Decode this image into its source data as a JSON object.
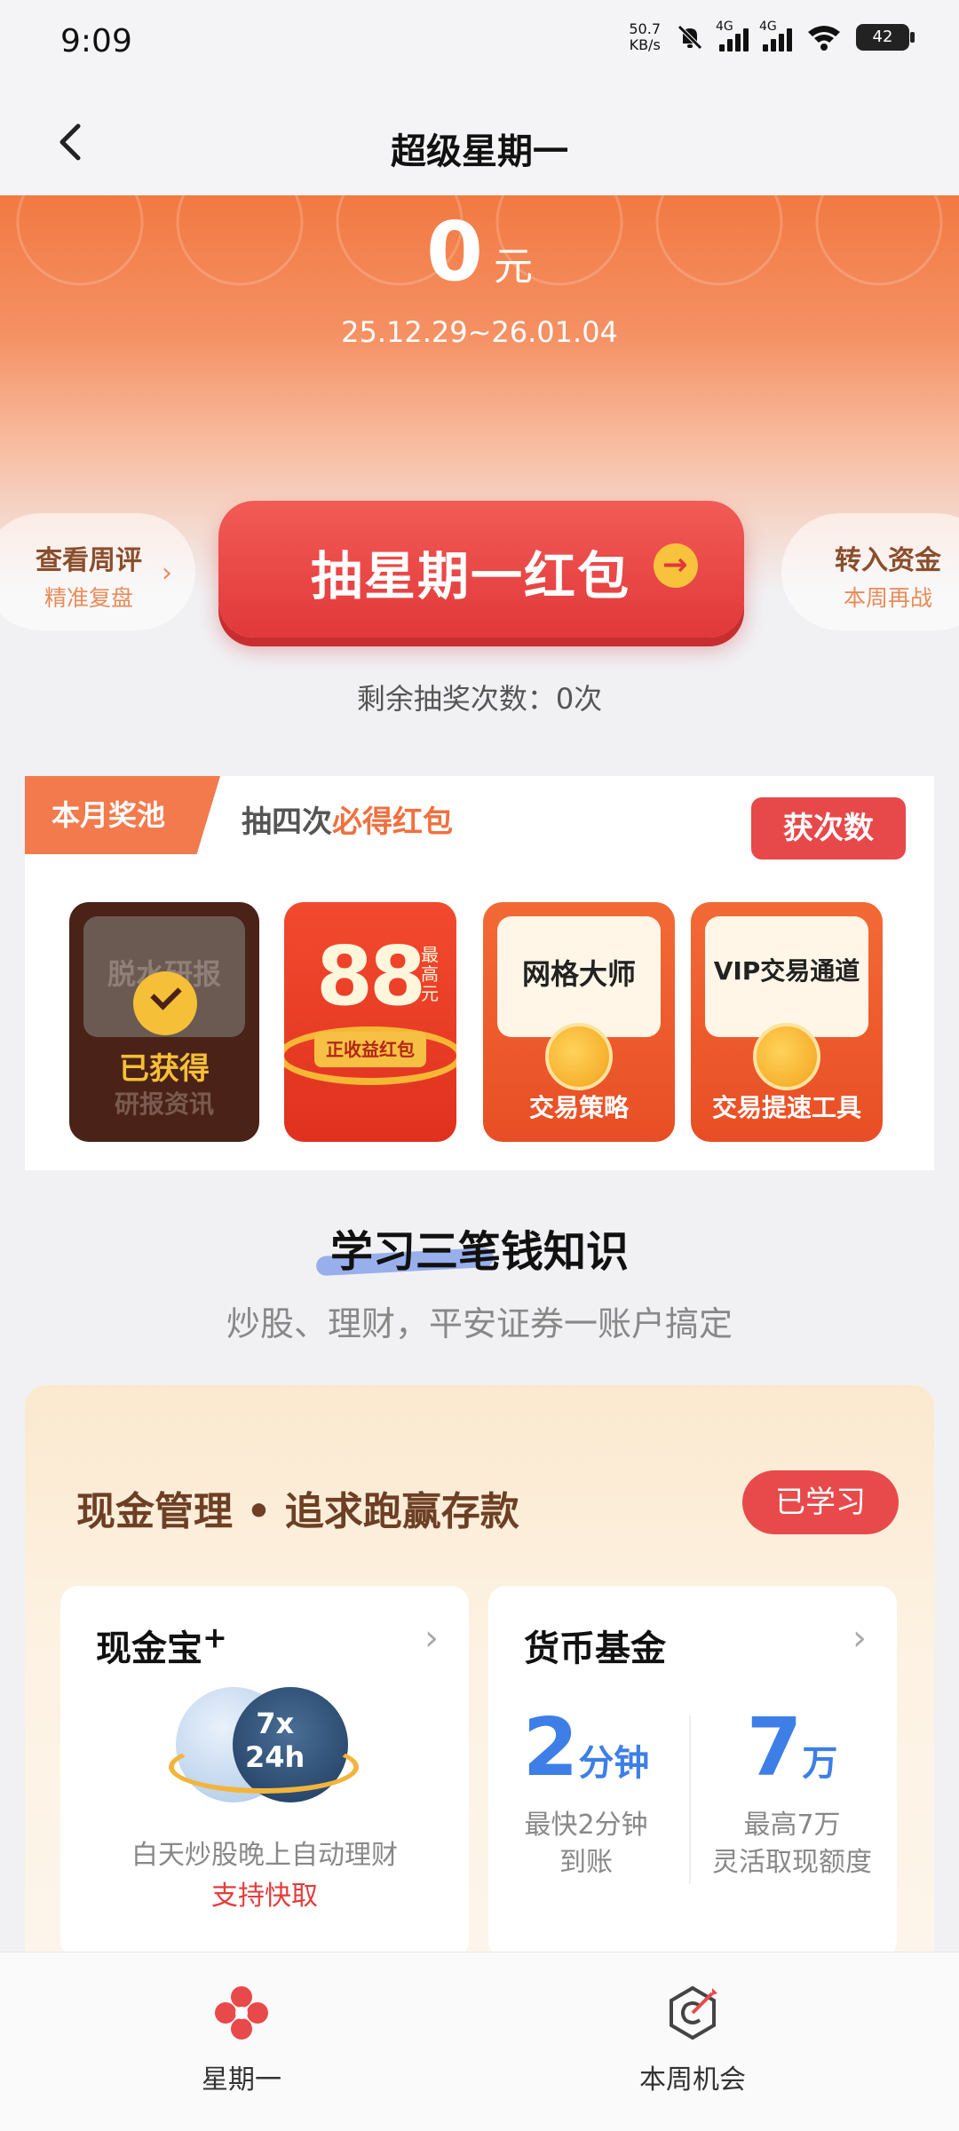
{
  "status_bar": {
    "time": "9:09",
    "net_speed_value": "50.7",
    "net_speed_unit": "KB/s",
    "signal_1": "4G",
    "signal_2": "4G",
    "battery": "42"
  },
  "header": {
    "title": "超级星期一"
  },
  "hero": {
    "amount": "0",
    "unit": "元",
    "date_range": "25.12.29~26.01.04"
  },
  "left_pill": {
    "line1": "查看周评",
    "line2": "精准复盘"
  },
  "right_pill": {
    "line1": "转入资金",
    "line2": "本周再战"
  },
  "draw_button": {
    "label": "抽星期一红包"
  },
  "remaining": "剩余抽奖次数：0次",
  "prize_pool": {
    "tab": "本月奖池",
    "subtitle_prefix": "抽四次",
    "subtitle_highlight": "必得红包",
    "get_button": "获次数",
    "envelopes": [
      {
        "title": "脱水研报",
        "badge": "已获得",
        "caption": "研报资讯"
      },
      {
        "big_number": "88",
        "small_text": "最高元",
        "tag": "正收益红包"
      },
      {
        "title": "网格大师",
        "caption": "交易策略"
      },
      {
        "title": "VIP交易通道",
        "caption": "交易提速工具"
      }
    ]
  },
  "learn": {
    "title": "学习三笔钱知识",
    "subtitle": "炒股、理财，平安证券一账户搞定"
  },
  "cash_section": {
    "title": "现金管理 • 追求跑赢存款",
    "learned_button": "已学习",
    "card_left": {
      "title": "现金宝",
      "superscript": "+",
      "orb_top": "7x",
      "orb_bottom": "24h",
      "desc": "白天炒股晚上自动理财",
      "fast": "支持快取"
    },
    "card_right": {
      "title": "货币基金",
      "stat1": {
        "value": "2",
        "unit": "分钟",
        "line1": "最快2分钟",
        "line2": "到账"
      },
      "stat2": {
        "value": "7",
        "unit": "万",
        "line1": "最高7万",
        "line2": "灵活取现额度"
      }
    }
  },
  "bottom_nav": {
    "item1": "星期一",
    "item2": "本周机会"
  },
  "colors": {
    "accent": "#e8494b",
    "orange": "#f27a4c",
    "blue_stat": "#3d7fe6"
  }
}
